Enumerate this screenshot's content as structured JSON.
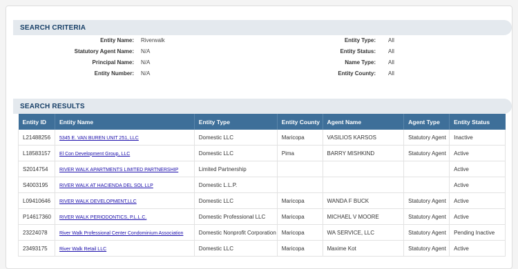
{
  "criteria": {
    "title": "SEARCH CRITERIA",
    "left": [
      {
        "label": "Entity Name:",
        "value": "Riverwalk"
      },
      {
        "label": "Statutory Agent Name:",
        "value": "N/A"
      },
      {
        "label": "Principal Name:",
        "value": "N/A"
      },
      {
        "label": "Entity Number:",
        "value": "N/A"
      }
    ],
    "right": [
      {
        "label": "Entity Type:",
        "value": "All"
      },
      {
        "label": "Entity Status:",
        "value": "All"
      },
      {
        "label": "Name Type:",
        "value": "All"
      },
      {
        "label": "Entity County:",
        "value": "All"
      }
    ]
  },
  "results": {
    "title": "SEARCH RESULTS",
    "columns": [
      "Entity ID",
      "Entity Name",
      "Entity Type",
      "Entity County",
      "Agent Name",
      "Agent Type",
      "Entity Status"
    ],
    "rows": [
      {
        "id": "L21488256",
        "name": "5345 E. VAN BUREN UNIT 251, LLC",
        "type": "Domestic LLC",
        "county": "Maricopa",
        "agent": "VASILIOS KARSOS",
        "agent_type": "Statutory Agent",
        "status": "Inactive"
      },
      {
        "id": "L18583157",
        "name": "El Con Development Group, LLC",
        "type": "Domestic LLC",
        "county": "Pima",
        "agent": "BARRY MISHKIND",
        "agent_type": "Statutory Agent",
        "status": "Active"
      },
      {
        "id": "S2014754",
        "name": "RIVER WALK APARTMENTS LIMITED PARTNERSHIP",
        "type": "Limited Partnership",
        "county": "",
        "agent": "",
        "agent_type": "",
        "status": "Active"
      },
      {
        "id": "S4003195",
        "name": "RIVER WALK AT HACIENDA DEL SOL LLP",
        "type": "Domestic L.L.P.",
        "county": "",
        "agent": "",
        "agent_type": "",
        "status": "Active"
      },
      {
        "id": "L09410646",
        "name": "RIVER WALK DEVELOPMENT,LLC",
        "type": "Domestic LLC",
        "county": "Maricopa",
        "agent": "WANDA F BUCK",
        "agent_type": "Statutory Agent",
        "status": "Active"
      },
      {
        "id": "P14617360",
        "name": "RIVER WALK PERIODONTICS, P.L.L.C.",
        "type": "Domestic Professional LLC",
        "county": "Maricopa",
        "agent": "MICHAEL V MOORE",
        "agent_type": "Statutory Agent",
        "status": "Active"
      },
      {
        "id": "23224078",
        "name": "River Walk Professional Center Condominium Association",
        "type": "Domestic Nonprofit Corporation",
        "county": "Maricopa",
        "agent": "WA SERVICE, LLC",
        "agent_type": "Statutory Agent",
        "status": "Pending Inactive"
      },
      {
        "id": "23493175",
        "name": "River Walk Retail LLC",
        "type": "Domestic LLC",
        "county": "Maricopa",
        "agent": "Maxime Kot",
        "agent_type": "Statutory Agent",
        "status": "Active"
      }
    ]
  }
}
